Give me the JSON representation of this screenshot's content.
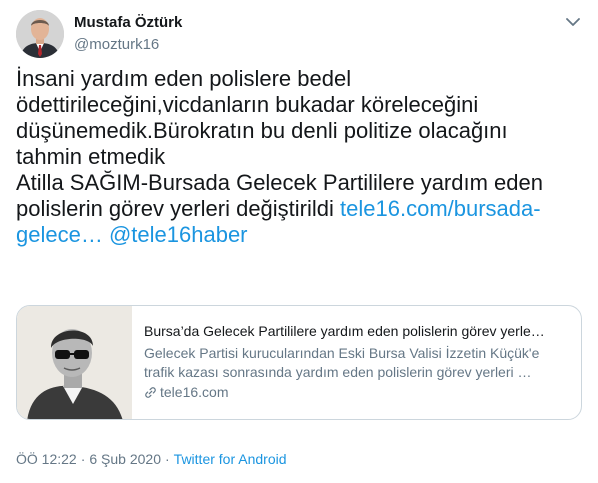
{
  "author": {
    "name": "Mustafa Öztürk",
    "handle": "@mozturk16"
  },
  "tweet": {
    "lines": [
      "İnsani yardım eden polislere bedel",
      "ödettirileceğini,vicdanların bukadar köreleceğini",
      "düşünemedik.Bürokratın bu denli politize olacağını",
      "tahmin etmedik",
      "Atilla SAĞIM-Bursada Gelecek Partililere yardım eden",
      "polislerin görev yerleri değiştirildi"
    ],
    "link_part1": "tele16.com/bursada-",
    "link_part2": "gelece…",
    "mention": "@tele16haber"
  },
  "card": {
    "title": "Bursa’da Gelecek Partililere yardım eden polislerin görev yerle…",
    "desc_line1": "Gelecek Partisi kurucularından Eski Bursa Valisi İzzetin Küçük'e",
    "desc_line2": "trafik kazası sonrasında yardım eden polislerin görev yerleri …",
    "domain": "tele16.com"
  },
  "meta": {
    "time": "ÖÖ 12:22",
    "separator1": "·",
    "date": "6 Şub 2020",
    "separator2": "·",
    "source": "Twitter for Android"
  },
  "icons": {
    "caret": "chevron-down-icon",
    "link": "link-icon"
  },
  "colors": {
    "link": "#1b95e0",
    "secondary_text": "#657786",
    "primary_text": "#14171a",
    "border": "#ccd6dd"
  }
}
